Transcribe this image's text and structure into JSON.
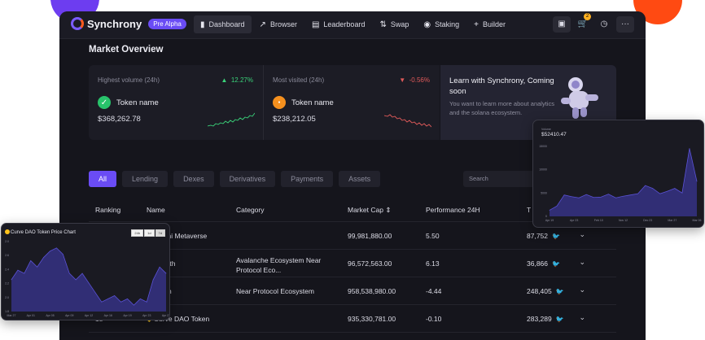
{
  "app": {
    "brand": "Synchrony",
    "badge": "Pre Alpha"
  },
  "nav": [
    {
      "label": "Dashboard",
      "icon": "bar-chart-icon",
      "active": true
    },
    {
      "label": "Browser",
      "icon": "trend-icon"
    },
    {
      "label": "Leaderboard",
      "icon": "leaderboard-icon"
    },
    {
      "label": "Swap",
      "icon": "swap-icon"
    },
    {
      "label": "Staking",
      "icon": "staking-icon"
    },
    {
      "label": "Builder",
      "icon": "plus-icon"
    }
  ],
  "toolbar": {
    "cart_count": "2",
    "icons": [
      "wallet-icon",
      "cart-icon",
      "clock-icon",
      "more-icon"
    ]
  },
  "overview": {
    "title": "Market Overview",
    "cards": [
      {
        "label": "Highest volume (24h)",
        "change": "12.27%",
        "direction": "up",
        "token": "Token name",
        "value": "$368,262.78"
      },
      {
        "label": "Most visited (24h)",
        "change": "-0.56%",
        "direction": "down",
        "token": "Token name",
        "value": "$238,212.05"
      }
    ],
    "learn": {
      "title": "Learn with Synchrony, Coming soon",
      "text": "You want to learn more about analytics and the solana ecosystem."
    }
  },
  "filters": [
    "All",
    "Lending",
    "Dexes",
    "Derivatives",
    "Payments",
    "Assets"
  ],
  "search": {
    "placeholder": "Search"
  },
  "table": {
    "headers": [
      "Ranking",
      "Name",
      "Category",
      "Market Cap",
      "Performance 24H",
      "T"
    ],
    "rows": [
      {
        "rank": "",
        "name": "nsoKishi Metaverse",
        "category": "",
        "cap": "99,981,880.00",
        "perf": "5.50",
        "tw": "87,752"
      },
      {
        "rank": "",
        "name": "mpleforth",
        "category": "Avalanche Ecosystem Near Protocol Eco...",
        "cap": "96,572,563.00",
        "perf": "6.13",
        "tw": "36,866"
      },
      {
        "rank": "",
        "name": "onbeam",
        "category": "Near Protocol Ecosystem",
        "cap": "958,538,980.00",
        "perf": "-4.44",
        "tw": "248,405"
      },
      {
        "rank": "18",
        "name": "Curve DAO Token",
        "category": "",
        "cap": "935,330,781.00",
        "perf": "-0.10",
        "tw": "283,289"
      }
    ]
  },
  "float_right": {
    "caption": "Volume",
    "value": "$52410.47",
    "y_ticks": [
      "15000",
      "10000",
      "5000",
      "0"
    ],
    "x_ticks": [
      "Apr 19",
      "Apr 23",
      "Feb 10",
      "Nov 12",
      "Dec 23",
      "Mar 27",
      "Mar 06"
    ]
  },
  "float_left": {
    "title": "Curve DAO Token  Price Chart",
    "ranges": [
      "24h",
      "1d",
      "7d"
    ],
    "y_ticks": [
      "2.0",
      "2.6",
      "2.4",
      "2.2",
      "2.0",
      "1.8"
    ],
    "x_ticks": [
      "Mar 27",
      "Apr 01",
      "Apr 05",
      "Apr 09",
      "Apr 12",
      "Apr 16",
      "Apr 19",
      "Apr 23",
      "Apr 27"
    ]
  },
  "colors": {
    "accent": "#6a4cf5",
    "up": "#3ad37a",
    "down": "#e05a5a",
    "orange": "#ff4a12",
    "purple": "#6d3df0"
  },
  "chart_data": [
    {
      "type": "area",
      "title": "",
      "xlabel": "",
      "ylabel": "",
      "x": [
        "Apr 19",
        "Apr 23",
        "Feb 10",
        "Nov 12",
        "Dec 23",
        "Mar 27",
        "Mar 06"
      ],
      "series": [
        {
          "values": [
            1500,
            2500,
            5200,
            4800,
            4500,
            5300,
            4600,
            4700,
            5400,
            4500,
            4900,
            5200,
            5500,
            7500,
            6800,
            5500,
            6100,
            6800,
            5700,
            16500,
            8500
          ]
        }
      ],
      "ylim": [
        0,
        17000
      ]
    },
    {
      "type": "area",
      "title": "Curve DAO Token  Price Chart",
      "xlabel": "",
      "ylabel": "",
      "x": [
        "Mar 27",
        "Apr 01",
        "Apr 05",
        "Apr 09",
        "Apr 12",
        "Apr 16",
        "Apr 19",
        "Apr 23",
        "Apr 27"
      ],
      "series": [
        {
          "values": [
            2.2,
            2.35,
            2.3,
            2.5,
            2.4,
            2.55,
            2.65,
            2.7,
            2.6,
            2.3,
            2.2,
            2.3,
            2.15,
            2.0,
            1.85,
            1.9,
            1.95,
            1.85,
            1.9,
            1.8,
            1.9,
            1.85,
            2.2,
            2.4,
            2.3
          ]
        }
      ],
      "ylim": [
        1.7,
        2.8
      ]
    }
  ]
}
